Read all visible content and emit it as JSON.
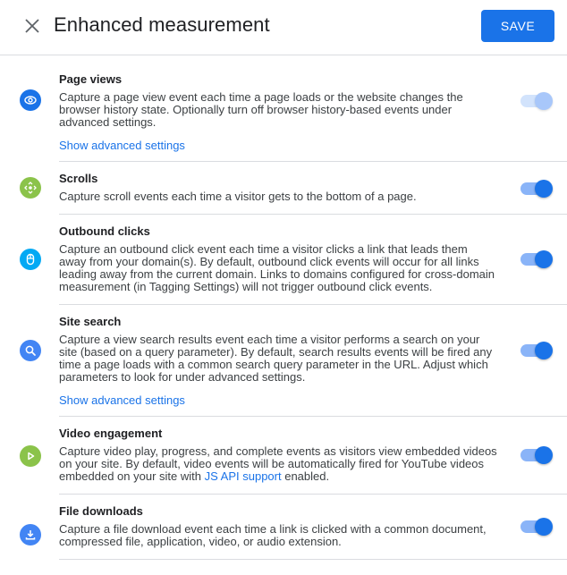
{
  "header": {
    "title": "Enhanced measurement",
    "close_icon": "close-icon",
    "save_label": "SAVE"
  },
  "colors": {
    "accent": "#1a73e8",
    "toggle_track_on": "#8ab4f8",
    "toggle_disabled_track": "#d2e3fc",
    "toggle_disabled_thumb": "#a8c7fa",
    "divider": "#dadce0"
  },
  "settings": [
    {
      "title": "Page views",
      "icon": "eye-icon",
      "icon_color": "#1a73e8",
      "description": "Capture a page view event each time a page loads or the website changes the browser history state. Optionally turn off browser history-based events under advanced settings.",
      "advanced_link": "Show advanced settings",
      "enabled": true,
      "toggle_disabled": true
    },
    {
      "title": "Scrolls",
      "icon": "scroll-arrows-icon",
      "icon_color": "#8bc34a",
      "description": "Capture scroll events each time a visitor gets to the bottom of a page.",
      "enabled": true,
      "toggle_disabled": false
    },
    {
      "title": "Outbound clicks",
      "icon": "mouse-icon",
      "icon_color": "#03a9f4",
      "description": "Capture an outbound click event each time a visitor clicks a link that leads them away from your domain(s). By default, outbound click events will occur for all links leading away from the current domain. Links to domains configured for cross-domain measurement (in Tagging Settings) will not trigger outbound click events.",
      "enabled": true,
      "toggle_disabled": false
    },
    {
      "title": "Site search",
      "icon": "search-icon",
      "icon_color": "#4285f4",
      "description": "Capture a view search results event each time a visitor performs a search on your site (based on a query parameter). By default, search results events will be fired any time a page loads with a common search query parameter in the URL. Adjust which parameters to look for under advanced settings.",
      "advanced_link": "Show advanced settings",
      "enabled": true,
      "toggle_disabled": false
    },
    {
      "title": "Video engagement",
      "icon": "play-icon",
      "icon_color": "#8bc34a",
      "description_before": "Capture video play, progress, and complete events as visitors view embedded videos on your site. By default, video events will be automatically fired for YouTube videos embedded on your site with ",
      "description_link": "JS API support",
      "description_after": " enabled.",
      "enabled": true,
      "toggle_disabled": false
    },
    {
      "title": "File downloads",
      "icon": "download-icon",
      "icon_color": "#4285f4",
      "description": "Capture a file download event each time a link is clicked with a common document, compressed file, application, video, or audio extension.",
      "enabled": true,
      "toggle_disabled": false
    }
  ]
}
